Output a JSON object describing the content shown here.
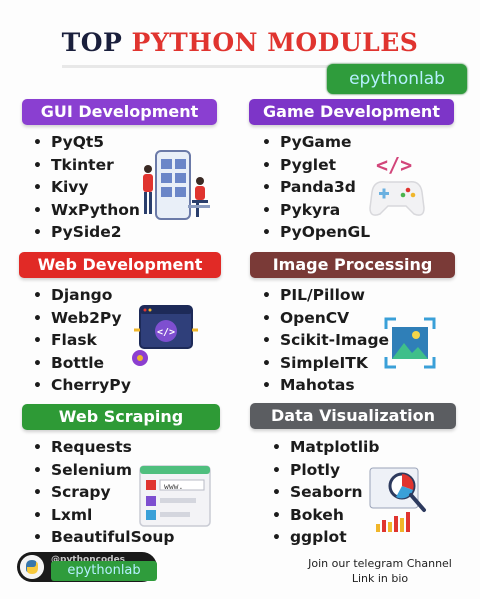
{
  "title": {
    "part1": "TOP",
    "part2": "PYTHON MODULES"
  },
  "watermark": "epythonlab",
  "colors": {
    "gui": "#8a3fd1",
    "game": "#7d35c8",
    "web": "#e12a26",
    "image": "#7a3a37",
    "scraping": "#2e9a36",
    "dataviz": "#5b5d61",
    "accent_red": "#e0342f",
    "title_dark": "#1a1f3c"
  },
  "sections": {
    "gui": {
      "title": "GUI Development",
      "items": [
        "PyQt5",
        "Tkinter",
        "Kivy",
        "WxPython",
        "PySide2"
      ],
      "icon": "gui-developers-illustration"
    },
    "game": {
      "title": "Game Development",
      "items": [
        "PyGame",
        "Pyglet",
        "Panda3d",
        "Pykyra",
        "PyOpenGL"
      ],
      "icon": "gamepad-icon"
    },
    "web": {
      "title": "Web Development",
      "items": [
        "Django",
        "Web2Py",
        "Flask",
        "Bottle",
        "CherryPy"
      ],
      "icon": "code-window-icon"
    },
    "image": {
      "title": "Image Processing",
      "items": [
        "PIL/Pillow",
        "OpenCV",
        "Scikit-Image",
        "SimpleITK",
        "Mahotas"
      ],
      "icon": "image-frame-icon"
    },
    "scraping": {
      "title": "Web Scraping",
      "items": [
        "Requests",
        "Selenium",
        "Scrapy",
        "Lxml",
        "BeautifulSoup"
      ],
      "icon": "browser-www-icon"
    },
    "dataviz": {
      "title": "Data Visualization",
      "items": [
        "Matplotlib",
        "Plotly",
        "Seaborn",
        "Bokeh",
        "ggplot"
      ],
      "icon": "chart-magnifier-icon"
    }
  },
  "footer": {
    "handle": "@pythoncodes",
    "watermark": "epythonlab",
    "join_line1": "Join our telegram Channel",
    "join_line2": "Link in bio"
  }
}
